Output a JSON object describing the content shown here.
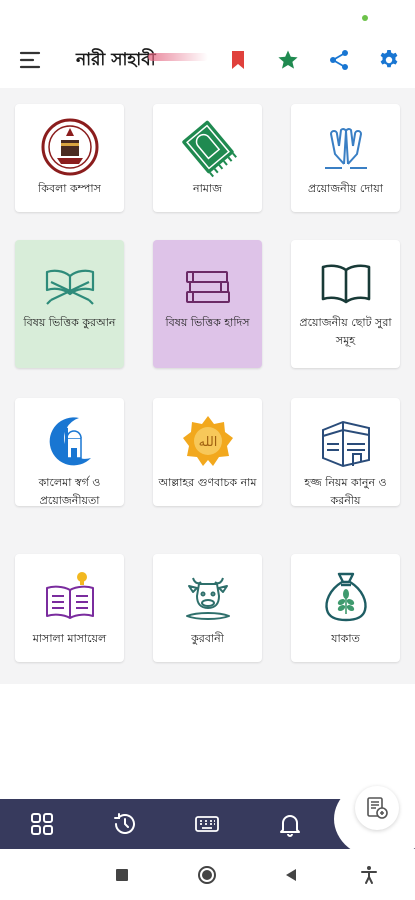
{
  "header": {
    "title": "নারী সাহাবী",
    "icons": [
      "menu-icon",
      "bookmark-icon",
      "star-icon",
      "share-icon",
      "gear-icon"
    ]
  },
  "colors": {
    "accent_green": "#1f8a50",
    "accent_red": "#e0413c",
    "accent_blue": "#1976d2",
    "nav_bar": "#373a5d",
    "highlight_green": "#d8edd9",
    "highlight_purple": "#dec3e8"
  },
  "tiles": [
    {
      "label": "কিবলা কম্পাস",
      "icon": "qibla-compass-icon"
    },
    {
      "label": "নামাজ",
      "icon": "prayer-mat-icon"
    },
    {
      "label": "প্রয়োজনীয় দোয়া",
      "icon": "praying-hands-icon"
    },
    {
      "label": "বিষয় ভিত্তিক কুরআন",
      "icon": "quran-stand-icon"
    },
    {
      "label": "বিষয় ভিত্তিক হাদিস",
      "icon": "books-stack-icon"
    },
    {
      "label": "প্রয়োজনীয় ছোট সুরা সমূহ",
      "icon": "open-book-icon"
    },
    {
      "label": "কালেমা স্বর্গ ও প্রয়োজনীয়তা",
      "icon": "mosque-moon-icon"
    },
    {
      "label": "আল্লাহর গুণবাচক নাম",
      "icon": "allah-star-icon"
    },
    {
      "label": "হজ্জ নিয়ম কানুন ও করনীয়",
      "icon": "kaaba-icon"
    },
    {
      "label": "মাসালা মাসায়েল",
      "icon": "idea-book-icon"
    },
    {
      "label": "কুরবানী",
      "icon": "cow-icon"
    },
    {
      "label": "যাকাত",
      "icon": "money-bag-icon"
    }
  ],
  "bottom_nav": [
    "grid-icon",
    "history-icon",
    "keyboard-icon",
    "bell-icon",
    "calculator-doc-icon"
  ],
  "system_nav": [
    "recents-icon",
    "home-icon",
    "back-icon",
    "accessibility-icon"
  ]
}
